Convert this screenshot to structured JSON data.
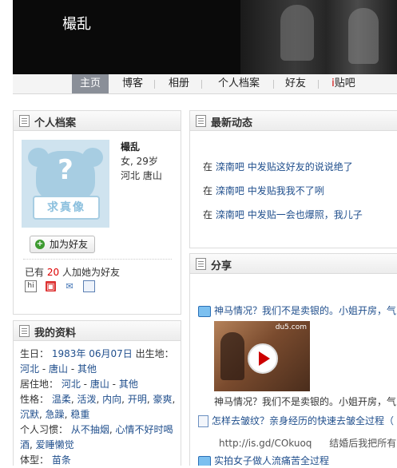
{
  "header": {
    "title": "樶乱"
  },
  "nav": {
    "items": [
      {
        "label": "主页"
      },
      {
        "label": "博客"
      },
      {
        "label": "相册"
      },
      {
        "label": "个人档案"
      },
      {
        "label": "好友"
      }
    ],
    "tieba_prefix": "i",
    "tieba_suffix": "贴吧"
  },
  "profile": {
    "title": "个人档案",
    "avatar_text": "求真像",
    "name": "樶乱",
    "gender_age": "女, 29岁",
    "location": "河北 唐山",
    "add_friend_label": "加为好友",
    "friends_prefix": "已有",
    "friends_count": "20",
    "friends_suffix": "人加她为好友"
  },
  "details": {
    "title": "我的资料",
    "birthday_label": "生日：",
    "birthday_value": "1983年 06月07日",
    "birthplace_label": "出生地：",
    "birthplace": [
      "河北",
      "唐山",
      "其他"
    ],
    "residence_label": "居住地：",
    "residence": [
      "河北",
      "唐山",
      "其他"
    ],
    "personality_label": "性格：",
    "personality": [
      "温柔",
      "活泼",
      "内向",
      "开明",
      "豪爽",
      "沉默",
      "急躁",
      "稳重"
    ],
    "habits_label": "个人习惯：",
    "habits": [
      "从不抽烟",
      "心情不好时喝酒",
      "爱睡懒觉"
    ],
    "body_label": "体型：",
    "body_value": "苗条"
  },
  "news": {
    "title": "最新动态",
    "items": [
      {
        "prefix": "在",
        "bar": "滦南吧",
        "text": "中发贴这好友的说说绝了"
      },
      {
        "prefix": "在",
        "bar": "滦南吧",
        "text": "中发贴我我不了咧"
      },
      {
        "prefix": "在",
        "bar": "滦南吧",
        "text": "中发贴一会也爆照，我儿子"
      }
    ]
  },
  "share": {
    "title": "分享",
    "items": [
      {
        "text": "神马情况？我们不是卖银的。小姐开房，气",
        "icon": "tv-icon"
      },
      {
        "text": "怎样去皱纹？亲身经历的快速去皱全过程（",
        "icon": "doc-icon"
      },
      {
        "text": "实拍女子做人流痛苦全过程",
        "icon": "tv-icon"
      }
    ],
    "video_caption": "神马情况？我们不是卖银的。小姐开房，气",
    "video_watermark": "du5.com",
    "url_text": "http://is.gd/COkuoq",
    "url_desc": "结婚后我把所有..."
  }
}
